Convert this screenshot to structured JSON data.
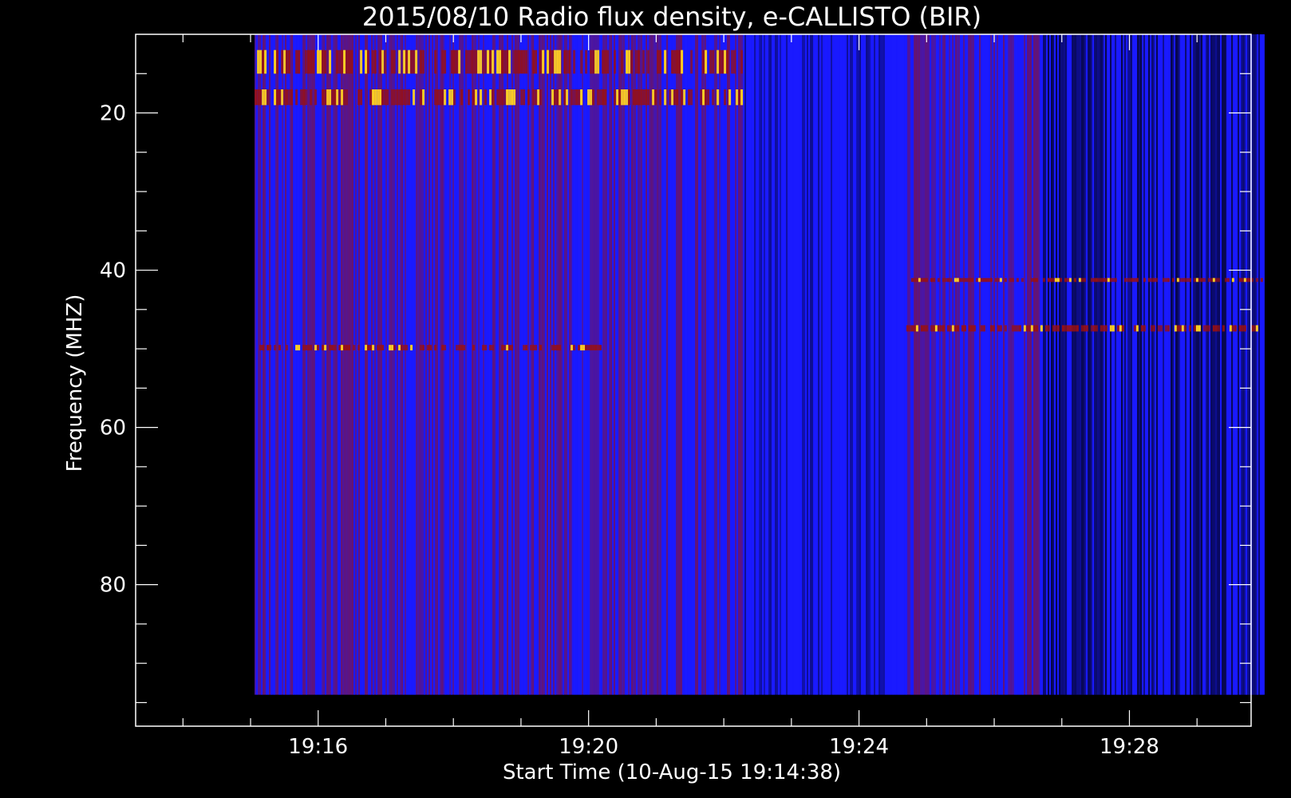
{
  "chart_data": {
    "type": "heatmap",
    "title": "2015/08/10  Radio flux density, e-CALLISTO (BIR)",
    "xlabel": "Start Time (10-Aug-15 19:14:38)",
    "ylabel": "Frequency (MHZ)",
    "x_major_ticks": [
      {
        "label": "19:16",
        "minutes": 16
      },
      {
        "label": "19:20",
        "minutes": 20
      },
      {
        "label": "19:24",
        "minutes": 24
      },
      {
        "label": "19:28",
        "minutes": 28
      }
    ],
    "x_range_minutes": [
      13.3,
      29.8
    ],
    "data_x_range_minutes": [
      15.06,
      30.0
    ],
    "y_major_ticks": [
      {
        "label": "20",
        "value": 20
      },
      {
        "label": "40",
        "value": 40
      },
      {
        "label": "60",
        "value": 60
      },
      {
        "label": "80",
        "value": 80
      }
    ],
    "y_range": [
      10,
      98
    ],
    "data_y_range": [
      10,
      94
    ],
    "y_inverted": true,
    "colors": {
      "background": "#000000",
      "low": "#000000",
      "mid": "#1a1aff",
      "high": "#9a1010",
      "peak": "#ffd020"
    },
    "features": [
      {
        "kind": "band",
        "freq": [
          12,
          15
        ],
        "time": [
          15.06,
          22.3
        ],
        "level": "peak"
      },
      {
        "kind": "band",
        "freq": [
          17,
          19
        ],
        "time": [
          15.06,
          22.3
        ],
        "level": "peak"
      },
      {
        "kind": "band",
        "freq": [
          41,
          41.5
        ],
        "time": [
          24.7,
          30.0
        ],
        "level": "high"
      },
      {
        "kind": "band",
        "freq": [
          47,
          47.8
        ],
        "time": [
          24.7,
          30.0
        ],
        "level": "high"
      },
      {
        "kind": "band",
        "freq": [
          49.5,
          50.2
        ],
        "time": [
          15.06,
          20.3
        ],
        "level": "high"
      },
      {
        "kind": "region",
        "freq": [
          10,
          94
        ],
        "time": [
          22.3,
          24.7
        ],
        "level": "mid"
      },
      {
        "kind": "region",
        "freq": [
          10,
          94
        ],
        "time": [
          26.7,
          30.0
        ],
        "level": "low"
      }
    ]
  }
}
